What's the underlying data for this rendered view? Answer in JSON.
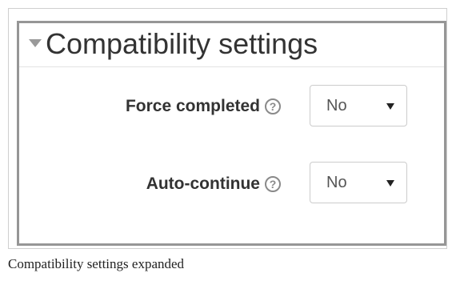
{
  "section": {
    "title": "Compatibility settings",
    "collapse_icon": "triangle-down-icon"
  },
  "fields": [
    {
      "label": "Force completed",
      "help_icon": "help-icon",
      "help_glyph": "?",
      "value": "No"
    },
    {
      "label": "Auto-continue",
      "help_icon": "help-icon",
      "help_glyph": "?",
      "value": "No"
    }
  ],
  "caption": "Compatibility settings expanded"
}
